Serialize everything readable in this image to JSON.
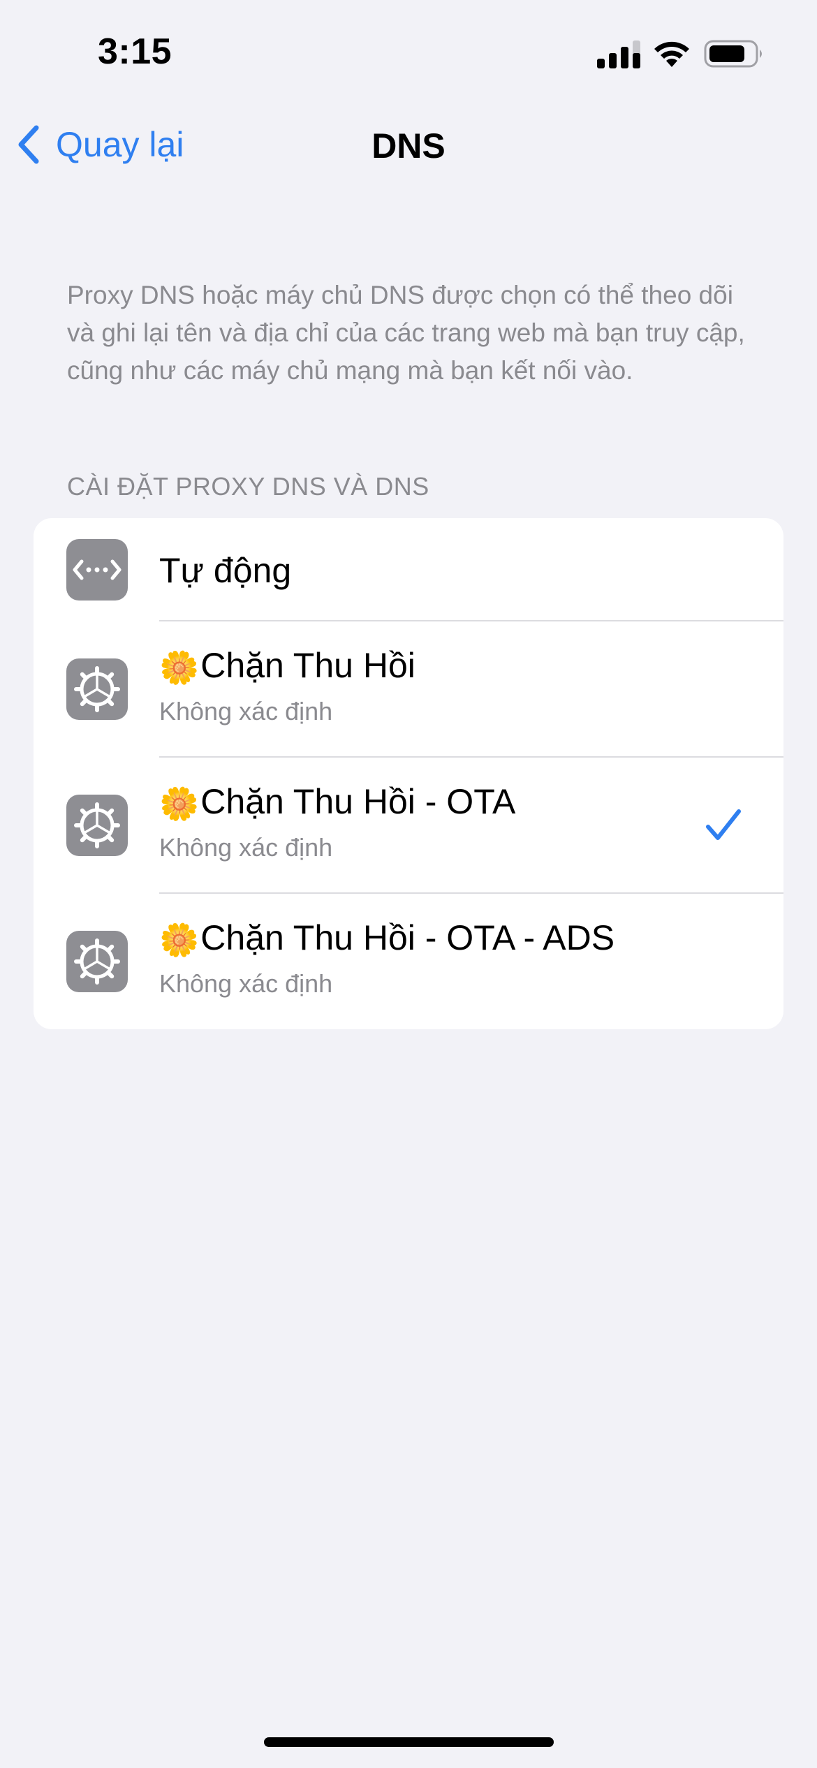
{
  "status_bar": {
    "time": "3:15",
    "signal_icon": "cellular-signal-icon",
    "wifi_icon": "wifi-icon",
    "battery_icon": "battery-icon"
  },
  "nav": {
    "back_label": "Quay lại",
    "title": "DNS",
    "back_icon": "chevron-left-icon"
  },
  "description": "Proxy DNS hoặc máy chủ DNS được chọn có thể theo dõi và ghi lại tên và địa chỉ của các trang web mà bạn truy cập, cũng như các máy chủ mạng mà bạn kết nối vào.",
  "section_header": "CÀI ĐẶT PROXY DNS VÀ DNS",
  "options": [
    {
      "title": "Tự động",
      "subtitle": "",
      "icon": "network-arrows-icon",
      "selected": false
    },
    {
      "emoji": "🌼",
      "title": "Chặn Thu Hồi",
      "subtitle": "Không xác định",
      "icon": "gear-icon",
      "selected": false
    },
    {
      "emoji": "🌼",
      "title": "Chặn Thu Hồi - OTA",
      "subtitle": "Không xác định",
      "icon": "gear-icon",
      "selected": true
    },
    {
      "emoji": "🌼",
      "title": "Chặn Thu Hồi - OTA - ADS",
      "subtitle": "Không xác định",
      "icon": "gear-icon",
      "selected": false
    }
  ],
  "colors": {
    "accent": "#2f7ff0",
    "background": "#f2f2f7",
    "secondary_text": "#8a8a8f",
    "icon_background": "#8e8e93"
  }
}
